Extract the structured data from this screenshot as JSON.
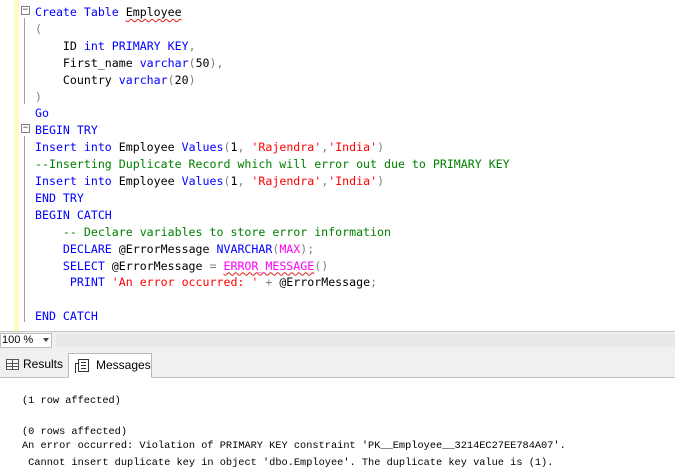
{
  "editor": {
    "lines": [
      {
        "segments": [
          {
            "t": "Create Table ",
            "c": "kw"
          },
          {
            "t": "Employee",
            "c": "squig"
          }
        ]
      },
      {
        "segments": [
          {
            "t": "(",
            "c": "gr"
          }
        ]
      },
      {
        "segments": [
          {
            "t": "    ID ",
            "c": ""
          },
          {
            "t": "int PRIMARY KEY",
            "c": "kw"
          },
          {
            "t": ",",
            "c": "gr"
          }
        ]
      },
      {
        "segments": [
          {
            "t": "    First_name ",
            "c": ""
          },
          {
            "t": "varchar",
            "c": "kw"
          },
          {
            "t": "(",
            "c": "gr"
          },
          {
            "t": "50",
            "c": ""
          },
          {
            "t": "),",
            "c": "gr"
          }
        ]
      },
      {
        "segments": [
          {
            "t": "    Country ",
            "c": ""
          },
          {
            "t": "varchar",
            "c": "kw"
          },
          {
            "t": "(",
            "c": "gr"
          },
          {
            "t": "20",
            "c": ""
          },
          {
            "t": ")",
            "c": "gr"
          }
        ]
      },
      {
        "segments": [
          {
            "t": ")",
            "c": "gr"
          }
        ]
      },
      {
        "segments": [
          {
            "t": "Go",
            "c": "kw"
          }
        ]
      },
      {
        "segments": [
          {
            "t": "BEGIN TRY",
            "c": "kw"
          }
        ]
      },
      {
        "segments": [
          {
            "t": "Insert into ",
            "c": "kw"
          },
          {
            "t": "Employee ",
            "c": ""
          },
          {
            "t": "Values",
            "c": "kw"
          },
          {
            "t": "(",
            "c": "gr"
          },
          {
            "t": "1",
            "c": ""
          },
          {
            "t": ", ",
            "c": "gr"
          },
          {
            "t": "'Rajendra'",
            "c": "str"
          },
          {
            "t": ",",
            "c": "gr"
          },
          {
            "t": "'India'",
            "c": "str"
          },
          {
            "t": ")",
            "c": "gr"
          }
        ]
      },
      {
        "segments": [
          {
            "t": "--Inserting Duplicate Record which will error out due to PRIMARY KEY",
            "c": "cm"
          }
        ]
      },
      {
        "segments": [
          {
            "t": "Insert into ",
            "c": "kw"
          },
          {
            "t": "Employee ",
            "c": ""
          },
          {
            "t": "Values",
            "c": "kw"
          },
          {
            "t": "(",
            "c": "gr"
          },
          {
            "t": "1",
            "c": ""
          },
          {
            "t": ", ",
            "c": "gr"
          },
          {
            "t": "'Rajendra'",
            "c": "str"
          },
          {
            "t": ",",
            "c": "gr"
          },
          {
            "t": "'India'",
            "c": "str"
          },
          {
            "t": ")",
            "c": "gr"
          }
        ]
      },
      {
        "segments": [
          {
            "t": "END TRY",
            "c": "kw"
          }
        ]
      },
      {
        "segments": [
          {
            "t": "BEGIN CATCH",
            "c": "kw"
          }
        ]
      },
      {
        "segments": [
          {
            "t": "    -- Declare variables to store error information",
            "c": "cm"
          }
        ]
      },
      {
        "segments": [
          {
            "t": "    DECLARE ",
            "c": "kw"
          },
          {
            "t": "@ErrorMessage ",
            "c": ""
          },
          {
            "t": "NVARCHAR",
            "c": "kw"
          },
          {
            "t": "(",
            "c": "gr"
          },
          {
            "t": "MAX",
            "c": "fn"
          },
          {
            "t": ");",
            "c": "gr"
          }
        ]
      },
      {
        "segments": [
          {
            "t": "    SELECT ",
            "c": "kw"
          },
          {
            "t": "@ErrorMessage ",
            "c": ""
          },
          {
            "t": "= ",
            "c": "gr"
          },
          {
            "t": "ERROR_MESSAGE",
            "c": "fn squig"
          },
          {
            "t": "()",
            "c": "gr"
          }
        ]
      },
      {
        "segments": [
          {
            "t": "     PRINT ",
            "c": "kw"
          },
          {
            "t": "'An error occurred: '",
            "c": "str"
          },
          {
            "t": " + ",
            "c": "gr"
          },
          {
            "t": "@ErrorMessage",
            "c": ""
          },
          {
            "t": ";",
            "c": "gr"
          }
        ]
      },
      {
        "segments": []
      },
      {
        "segments": [
          {
            "t": "END CATCH",
            "c": "kw"
          }
        ]
      }
    ]
  },
  "zoom": {
    "value": "100 %"
  },
  "tabs": {
    "results_label": "Results",
    "messages_label": "Messages"
  },
  "messages": {
    "lines": [
      "(1 row affected)",
      "(0 rows affected)",
      "An error occurred: Violation of PRIMARY KEY constraint 'PK__Employee__3214EC27EE784A07'.",
      " Cannot insert duplicate key in object 'dbo.Employee'. The duplicate key value is (1)."
    ]
  },
  "colors": {
    "keyword": "#0000ff",
    "string": "#ff0000",
    "comment": "#008000",
    "function": "#ff00ff",
    "punctuation": "#808080",
    "margin_highlight": "#fffbc4"
  }
}
